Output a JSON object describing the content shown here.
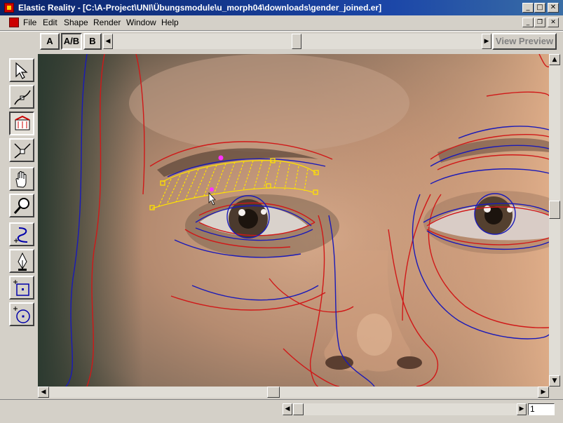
{
  "window": {
    "title": "Elastic Reality - [C:\\A-Project\\UNI\\Übungsmodule\\u_morph04\\downloads\\gender_joined.er]",
    "controls": [
      "minimize",
      "maximize",
      "close"
    ]
  },
  "menu": {
    "items": [
      {
        "label": "File"
      },
      {
        "label": "Edit"
      },
      {
        "label": "Shape"
      },
      {
        "label": "Render"
      },
      {
        "label": "Window"
      },
      {
        "label": "Help"
      }
    ]
  },
  "toolbar": {
    "a_label": "A",
    "ab_label": "A/B",
    "b_label": "B",
    "view_preview_label": "View Preview",
    "active_view": "A/B"
  },
  "tools": [
    {
      "name": "select-arrow-icon",
      "pressed": false
    },
    {
      "name": "point-edit-icon",
      "pressed": false
    },
    {
      "name": "correspondence-icon",
      "pressed": true
    },
    {
      "name": "join-icon",
      "pressed": false
    },
    {
      "name": "hand-pan-icon",
      "pressed": false
    },
    {
      "name": "zoom-magnifier-icon",
      "pressed": false
    },
    {
      "name": "freehand-curve-icon",
      "pressed": false
    },
    {
      "name": "pen-nib-icon",
      "pressed": false
    },
    {
      "name": "rectangle-shape-icon",
      "pressed": false
    },
    {
      "name": "circle-shape-icon",
      "pressed": false
    }
  ],
  "status": {
    "frame_number": "1"
  },
  "colors": {
    "title_bar": "#0a246a",
    "shape_a": "#d01818",
    "shape_b": "#1a1ab8",
    "selected_shape": "#ffe200",
    "point_selected": "#ff30ff"
  }
}
